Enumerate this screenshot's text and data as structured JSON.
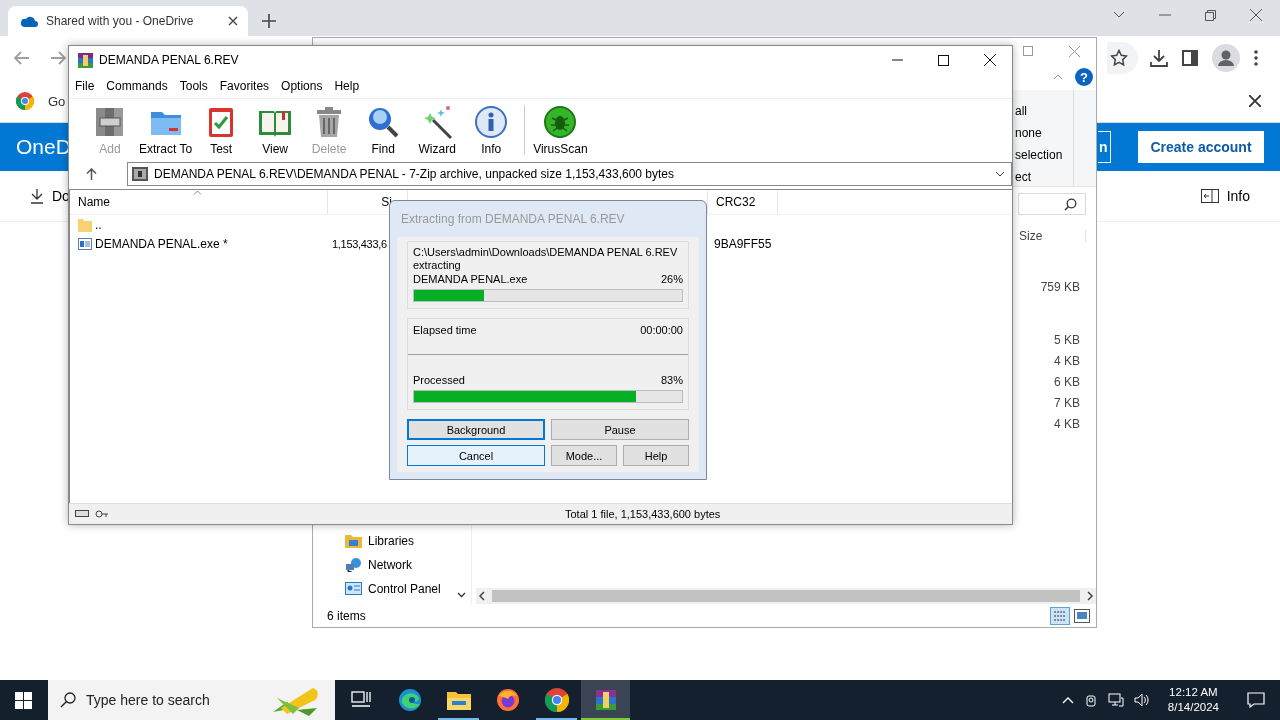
{
  "browser": {
    "tabs": [
      {
        "title": "Shared with you - OneDrive",
        "selected": true
      }
    ],
    "bookmarks": [
      {
        "label": "Go"
      }
    ],
    "page": {
      "logo": "OneD",
      "sign_in": "n",
      "create_account": "Create account",
      "command": "Do",
      "info": "Info"
    }
  },
  "explorer": {
    "ribbon_items": [
      "all",
      "none",
      "selection",
      "ect"
    ],
    "size_column": "Size",
    "size_groups": [
      [
        "759 KB"
      ],
      [
        "5 KB",
        "4 KB",
        "6 KB",
        "7 KB",
        "4 KB"
      ]
    ],
    "nav_items": [
      {
        "label": "Libraries",
        "kind": "libraries"
      },
      {
        "label": "Network",
        "kind": "network"
      },
      {
        "label": "Control Panel",
        "kind": "control-panel"
      }
    ],
    "status": "6 items",
    "help_label": "?"
  },
  "winrar": {
    "title": "DEMANDA PENAL 6.REV",
    "menu": [
      "File",
      "Commands",
      "Tools",
      "Favorites",
      "Options",
      "Help"
    ],
    "toolbar": [
      {
        "label": "Add",
        "kind": "add",
        "disabled": true
      },
      {
        "label": "Extract To",
        "kind": "extract",
        "disabled": false
      },
      {
        "label": "Test",
        "kind": "test",
        "disabled": false
      },
      {
        "label": "View",
        "kind": "view",
        "disabled": false
      },
      {
        "label": "Delete",
        "kind": "delete",
        "disabled": true
      },
      {
        "label": "Find",
        "kind": "find",
        "disabled": false
      },
      {
        "label": "Wizard",
        "kind": "wizard",
        "disabled": false
      },
      {
        "label": "Info",
        "kind": "info",
        "disabled": false
      },
      {
        "label": "VirusScan",
        "kind": "virusscan",
        "disabled": false
      }
    ],
    "path": "DEMANDA PENAL 6.REV\\DEMANDA PENAL - 7-Zip archive, unpacked size 1,153,433,600 bytes",
    "columns": {
      "name": "Name",
      "size": "Si",
      "crc": "CRC32"
    },
    "rows": [
      {
        "kind": "folder",
        "name": ".."
      },
      {
        "kind": "file",
        "name": "DEMANDA PENAL.exe *",
        "size": "1,153,433,6",
        "crc": "9BA9FF55"
      }
    ],
    "status": "Total 1 file, 1,153,433,600 bytes"
  },
  "dialog": {
    "title": "Extracting from DEMANDA PENAL 6.REV",
    "path": "C:\\Users\\admin\\Downloads\\DEMANDA PENAL 6.REV",
    "action": "extracting",
    "file": "DEMANDA PENAL.exe",
    "file_percent": "26%",
    "file_progress": {
      "level": 0.26
    },
    "elapsed_label": "Elapsed time",
    "elapsed": "00:00:00",
    "processed_label": "Processed",
    "processed_percent": "83%",
    "processed_progress": {
      "level": 0.83
    },
    "buttons": [
      {
        "label": "Background",
        "focused": true,
        "hovered": false
      },
      {
        "label": "Pause",
        "focused": false,
        "hovered": false
      },
      {
        "label": "Cancel",
        "focused": false,
        "hovered": true
      },
      {
        "label": "Mode...",
        "focused": false,
        "hovered": false
      },
      {
        "label": "Help",
        "focused": false,
        "hovered": false
      }
    ]
  },
  "taskbar": {
    "search_placeholder": "Type here to search",
    "apps": [
      {
        "kind": "task-view",
        "running": false,
        "selected": false
      },
      {
        "kind": "edge",
        "running": false,
        "selected": false
      },
      {
        "kind": "explorer",
        "running": true,
        "selected": false
      },
      {
        "kind": "firefox",
        "running": false,
        "selected": false
      },
      {
        "kind": "chrome",
        "running": true,
        "selected": false
      },
      {
        "kind": "winrar",
        "running": true,
        "selected": true
      }
    ],
    "time": "12:12 AM",
    "date": "8/14/2024"
  }
}
